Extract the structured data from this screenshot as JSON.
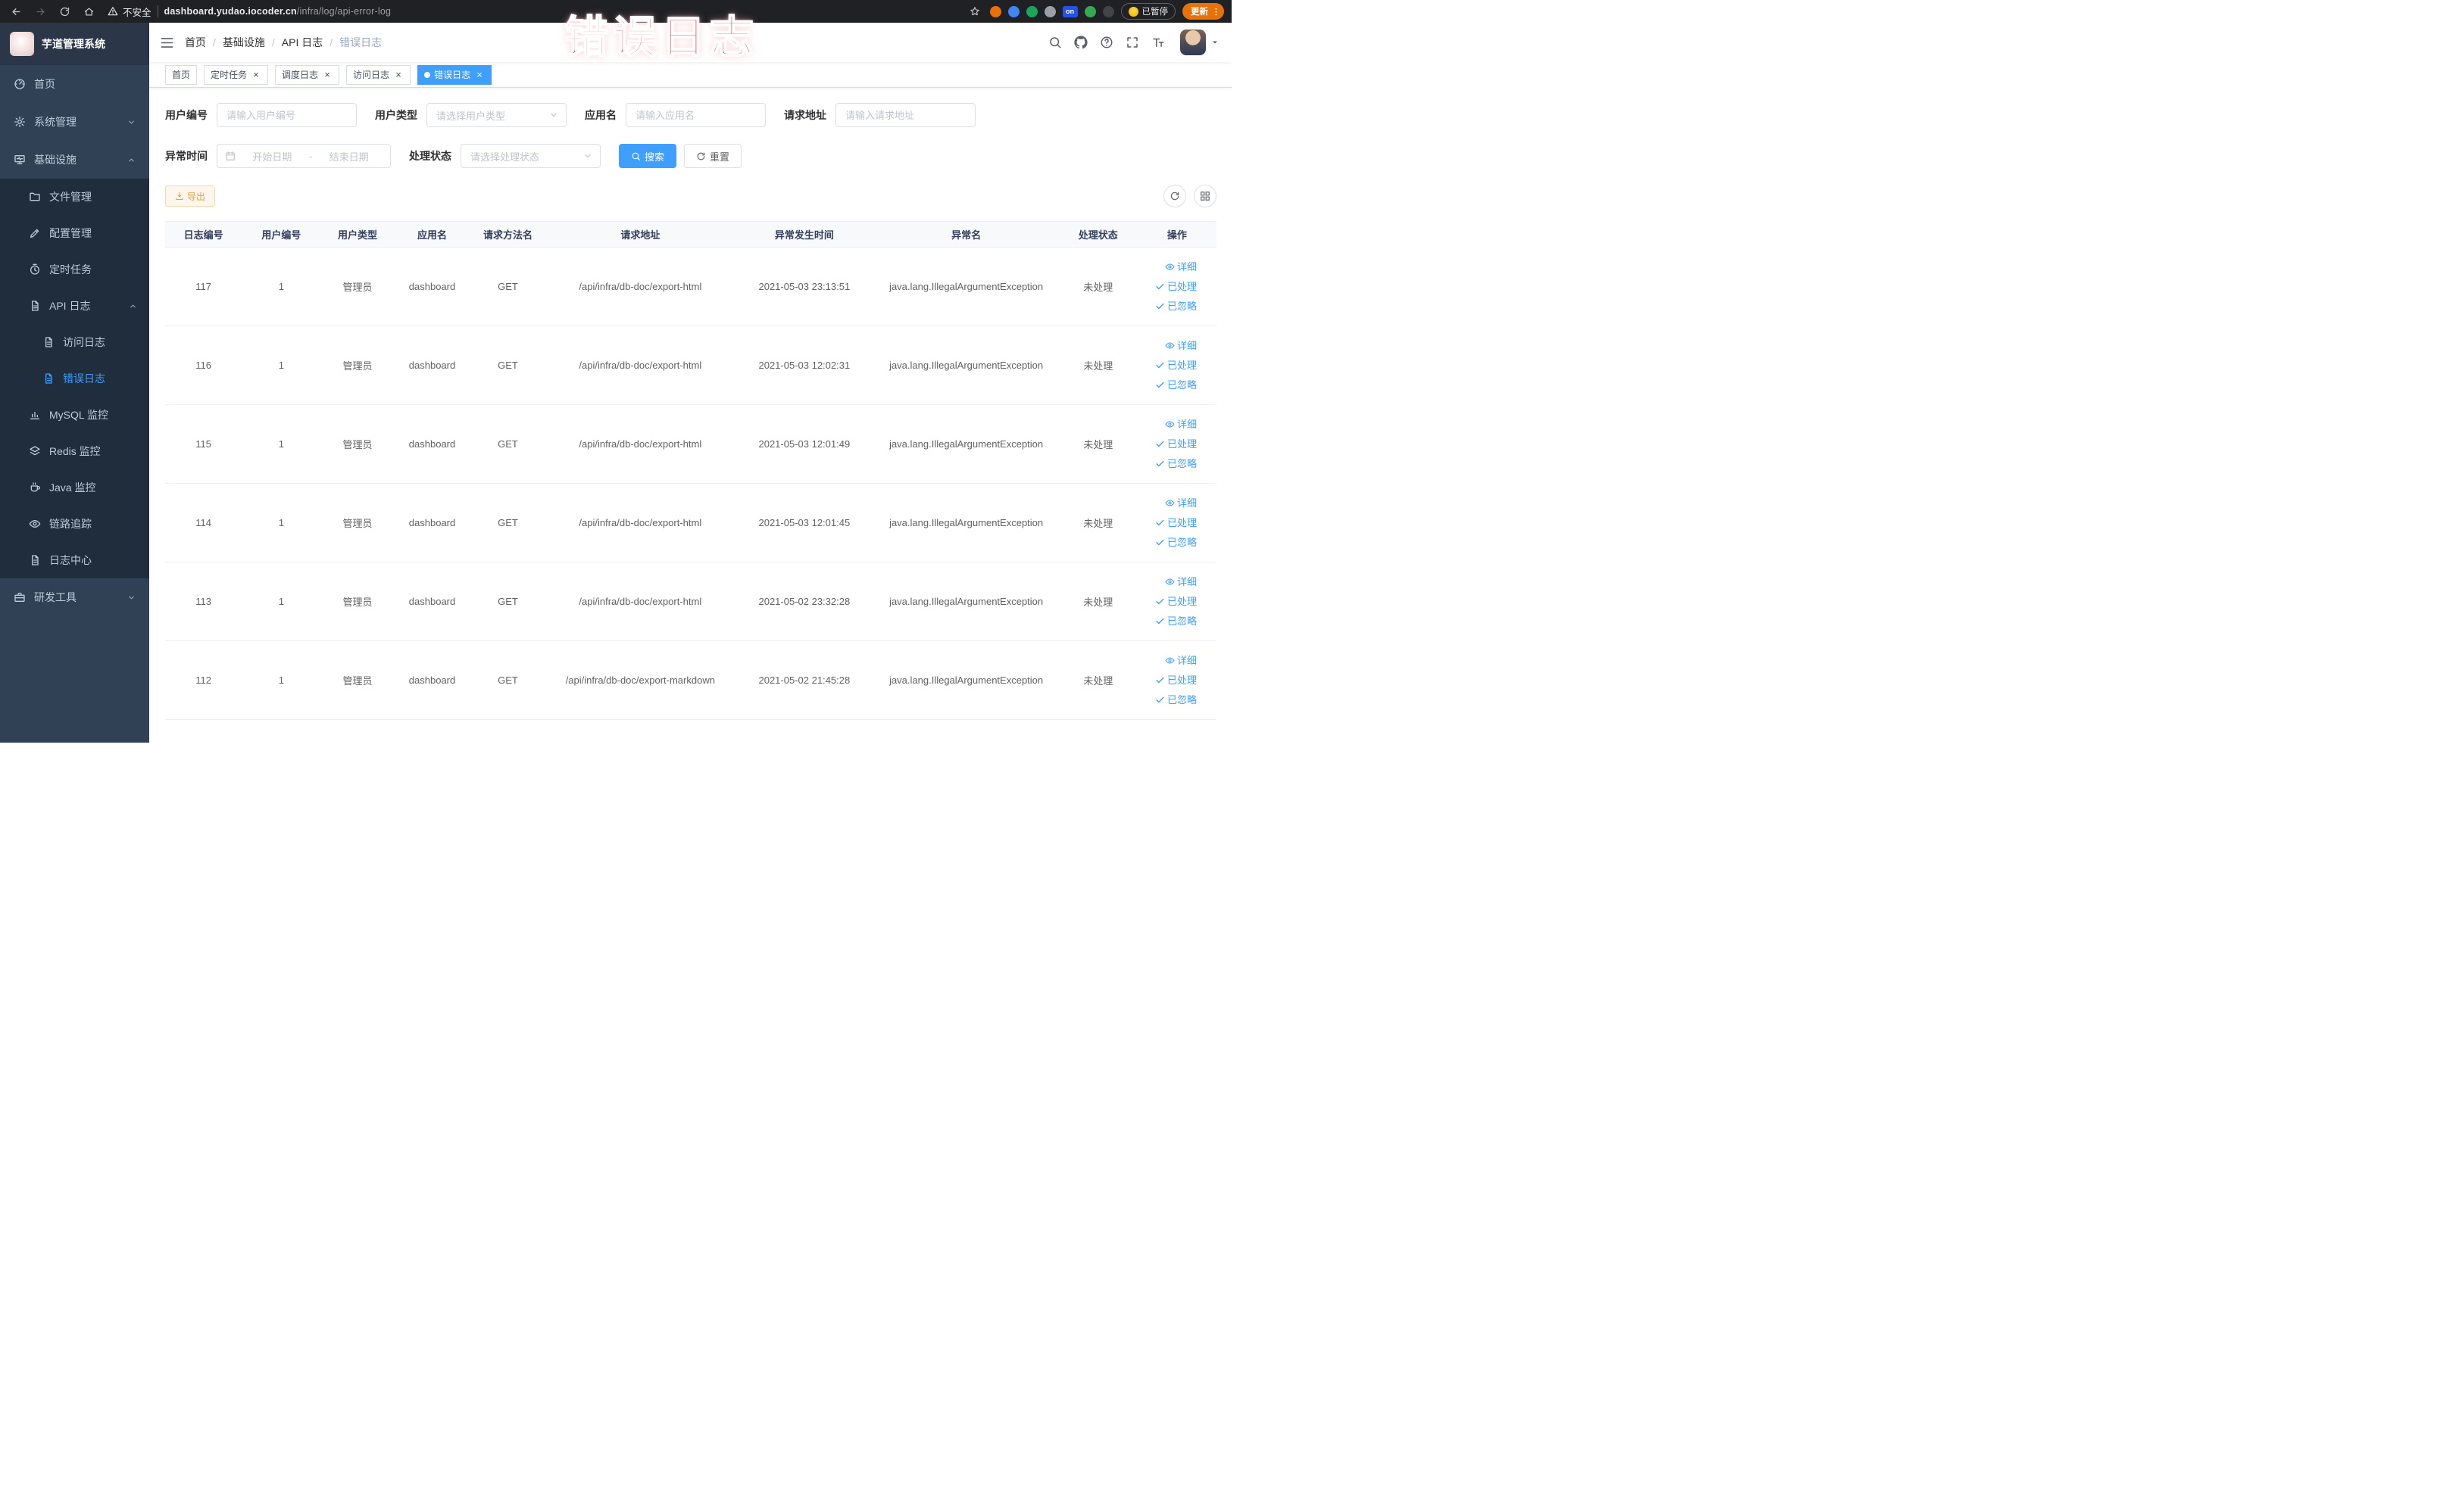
{
  "annotation": {
    "text": "错误日志"
  },
  "colors": {
    "accent": "#409eff",
    "warning": "#e6a23c",
    "sidebar_bg": "#304156",
    "submenu_bg": "#1f2d3d",
    "annotation": "#ef4056",
    "update_pill": "#e8710a"
  },
  "browser": {
    "nav_icons": [
      "back-icon",
      "forward-icon",
      "reload-icon",
      "home-icon"
    ],
    "security_label": "不安全",
    "url_domain": "dashboard.yudao.iocoder.cn",
    "url_path": "/infra/log/api-error-log",
    "extensions": [
      {
        "name": "extension-orange-icon",
        "color": "#e8710a"
      },
      {
        "name": "extension-blue-icon",
        "color": "#4285f4"
      },
      {
        "name": "extension-green-icon",
        "color": "#1ca45c"
      },
      {
        "name": "extension-gray-icon",
        "color": "#9aa0a6"
      },
      {
        "name": "extension-on-badge-icon",
        "color": "#2752e7",
        "label": "on"
      },
      {
        "name": "extension-leaf-icon",
        "color": "#34a853"
      },
      {
        "name": "extension-dark-icon",
        "color": "#41454a"
      }
    ],
    "paused_badge": "已暂停",
    "update_button": "更新"
  },
  "sidebar": {
    "logo_title": "芋道管理系统",
    "menu": [
      {
        "label": "首页",
        "icon": "dashboard-icon",
        "level": 1
      },
      {
        "label": "系统管理",
        "icon": "gear-icon",
        "level": 1,
        "chevron": "down"
      },
      {
        "label": "基础设施",
        "icon": "infrastructure-icon",
        "level": 1,
        "chevron": "up"
      },
      {
        "label": "文件管理",
        "icon": "folder-icon",
        "level": 2
      },
      {
        "label": "配置管理",
        "icon": "edit-icon",
        "level": 2
      },
      {
        "label": "定时任务",
        "icon": "timer-icon",
        "level": 2
      },
      {
        "label": "API 日志",
        "icon": "document-icon",
        "level": 2,
        "chevron": "up"
      },
      {
        "label": "访问日志",
        "icon": "document-icon",
        "level": 3
      },
      {
        "label": "错误日志",
        "icon": "document-icon",
        "level": 3,
        "active": true
      },
      {
        "label": "MySQL 监控",
        "icon": "chart-icon",
        "level": 2
      },
      {
        "label": "Redis 监控",
        "icon": "layers-icon",
        "level": 2
      },
      {
        "label": "Java 监控",
        "icon": "coffee-icon",
        "level": 2
      },
      {
        "label": "链路追踪",
        "icon": "eye-icon",
        "level": 2
      },
      {
        "label": "日志中心",
        "icon": "document-icon",
        "level": 2
      },
      {
        "label": "研发工具",
        "icon": "tools-icon",
        "level": 1,
        "chevron": "down"
      }
    ]
  },
  "navbar": {
    "breadcrumb": [
      "首页",
      "基础设施",
      "API 日志",
      "错误日志"
    ],
    "action_icons": [
      "search-icon",
      "github-icon",
      "help-icon",
      "fullscreen-icon",
      "font-size-icon"
    ]
  },
  "tabs": [
    {
      "label": "首页",
      "closable": false,
      "active": false
    },
    {
      "label": "定时任务",
      "closable": true,
      "active": false
    },
    {
      "label": "调度日志",
      "closable": true,
      "active": false
    },
    {
      "label": "访问日志",
      "closable": true,
      "active": false
    },
    {
      "label": "错误日志",
      "closable": true,
      "active": true
    }
  ],
  "filters": {
    "user_id": {
      "label": "用户编号",
      "placeholder": "请输入用户编号"
    },
    "user_type": {
      "label": "用户类型",
      "placeholder": "请选择用户类型"
    },
    "app_name": {
      "label": "应用名",
      "placeholder": "请输入应用名"
    },
    "request_url": {
      "label": "请求地址",
      "placeholder": "请输入请求地址"
    },
    "exception_time": {
      "label": "异常时间",
      "start_placeholder": "开始日期",
      "separator": "-",
      "end_placeholder": "结束日期"
    },
    "process_status": {
      "label": "处理状态",
      "placeholder": "请选择处理状态"
    },
    "search_button": "搜索",
    "reset_button": "重置"
  },
  "toolbar": {
    "export_label": "导出",
    "icon_buttons": [
      "refresh-icon",
      "grid-icon"
    ]
  },
  "table": {
    "headers": [
      "日志编号",
      "用户编号",
      "用户类型",
      "应用名",
      "请求方法名",
      "请求地址",
      "异常发生时间",
      "异常名",
      "处理状态",
      "操作"
    ],
    "actions": [
      {
        "key": "detail",
        "label": "详细",
        "icon": "eye-icon"
      },
      {
        "key": "processed",
        "label": "已处理",
        "icon": "check-icon"
      },
      {
        "key": "ignore",
        "label": "已忽略",
        "icon": "check-icon"
      }
    ],
    "rows": [
      {
        "id": "117",
        "user_id": "1",
        "user_type": "管理员",
        "app": "dashboard",
        "method": "GET",
        "url": "/api/infra/db-doc/export-html",
        "time": "2021-05-03 23:13:51",
        "exception": "java.lang.IllegalArgumentException",
        "status": "未处理"
      },
      {
        "id": "116",
        "user_id": "1",
        "user_type": "管理员",
        "app": "dashboard",
        "method": "GET",
        "url": "/api/infra/db-doc/export-html",
        "time": "2021-05-03 12:02:31",
        "exception": "java.lang.IllegalArgumentException",
        "status": "未处理"
      },
      {
        "id": "115",
        "user_id": "1",
        "user_type": "管理员",
        "app": "dashboard",
        "method": "GET",
        "url": "/api/infra/db-doc/export-html",
        "time": "2021-05-03 12:01:49",
        "exception": "java.lang.IllegalArgumentException",
        "status": "未处理"
      },
      {
        "id": "114",
        "user_id": "1",
        "user_type": "管理员",
        "app": "dashboard",
        "method": "GET",
        "url": "/api/infra/db-doc/export-html",
        "time": "2021-05-03 12:01:45",
        "exception": "java.lang.IllegalArgumentException",
        "status": "未处理"
      },
      {
        "id": "113",
        "user_id": "1",
        "user_type": "管理员",
        "app": "dashboard",
        "method": "GET",
        "url": "/api/infra/db-doc/export-html",
        "time": "2021-05-02 23:32:28",
        "exception": "java.lang.IllegalArgumentException",
        "status": "未处理"
      },
      {
        "id": "112",
        "user_id": "1",
        "user_type": "管理员",
        "app": "dashboard",
        "method": "GET",
        "url": "/api/infra/db-doc/export-markdown",
        "time": "2021-05-02 21:45:28",
        "exception": "java.lang.IllegalArgumentException",
        "status": "未处理"
      }
    ]
  }
}
